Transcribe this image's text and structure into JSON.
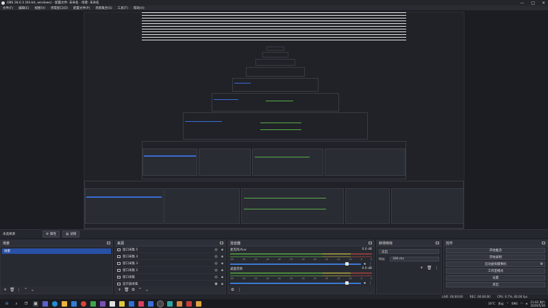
{
  "window": {
    "title": "OBS 28.0.3 (64-bit, windows) - 配置文件: 未命名 - 场景: 未命名",
    "controls": [
      "—",
      "□",
      "✕"
    ]
  },
  "menu": [
    "文件(F)",
    "编辑(E)",
    "视图(V)",
    "停靠窗口(D)",
    "配置文件(P)",
    "场景集合(S)",
    "工具(T)",
    "帮助(H)"
  ],
  "scene_bar": {
    "label": "未选择源",
    "properties_button": "属性",
    "filters_button": "滤镜"
  },
  "scenes": {
    "title": "场景",
    "items": [
      "场景"
    ]
  },
  "sources": {
    "title": "来源",
    "items": [
      "窗口采集 5",
      "窗口采集 4",
      "窗口采集 3",
      "窗口采集 2",
      "窗口采集",
      "显示器采集"
    ]
  },
  "mixer": {
    "title": "混音器",
    "tracks": [
      {
        "name": "麦克风/Aux",
        "db": "0.0 dB"
      },
      {
        "name": "桌面音频",
        "db": "0.0 dB"
      }
    ],
    "ticks": [
      "-60",
      "-55",
      "-50",
      "-45",
      "-40",
      "-35",
      "-30",
      "-25",
      "-20",
      "-15",
      "-10",
      "-5",
      "0"
    ]
  },
  "transitions": {
    "title": "转场特效",
    "type": "淡出",
    "duration_label": "时长",
    "duration_value": "300 ms"
  },
  "controls": {
    "title": "控件",
    "buttons": [
      "开始推流",
      "开始录制",
      "启动虚拟摄像机",
      "工作室模式",
      "设置",
      "退出"
    ]
  },
  "status": {
    "live": "LIVE: 00:00:00",
    "rec": "REC: 00:00:00",
    "cpu": "CPU: 0.7%, 60.00 fps"
  },
  "taskbar": {
    "weather": "16°C",
    "weather_desc": "多云",
    "lang": "ENG",
    "time": "21:02 周六",
    "date": "2020/5/30"
  },
  "colors": {
    "accent": "#2850a6",
    "meter_green": "#4c8a3c",
    "fader_blue": "#3c7bd6"
  }
}
